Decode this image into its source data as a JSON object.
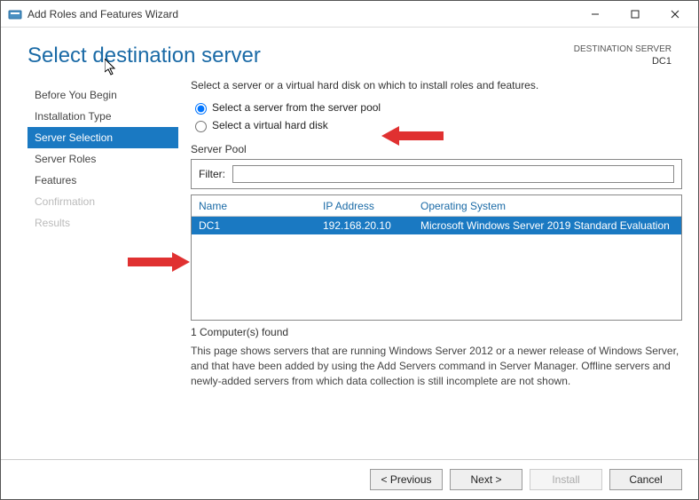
{
  "window": {
    "title": "Add Roles and Features Wizard"
  },
  "page": {
    "title": "Select destination server",
    "dest_label": "DESTINATION SERVER",
    "dest_name": "DC1"
  },
  "nav": {
    "items": [
      {
        "label": "Before You Begin",
        "state": "normal"
      },
      {
        "label": "Installation Type",
        "state": "normal"
      },
      {
        "label": "Server Selection",
        "state": "selected"
      },
      {
        "label": "Server Roles",
        "state": "normal"
      },
      {
        "label": "Features",
        "state": "normal"
      },
      {
        "label": "Confirmation",
        "state": "disabled"
      },
      {
        "label": "Results",
        "state": "disabled"
      }
    ]
  },
  "content": {
    "instruction": "Select a server or a virtual hard disk on which to install roles and features.",
    "radio1": "Select a server from the server pool",
    "radio2": "Select a virtual hard disk",
    "section_label": "Server Pool",
    "filter_label": "Filter:",
    "filter_value": "",
    "columns": {
      "name": "Name",
      "ip": "IP Address",
      "os": "Operating System"
    },
    "rows": [
      {
        "name": "DC1",
        "ip": "192.168.20.10",
        "os": "Microsoft Windows Server 2019 Standard Evaluation"
      }
    ],
    "count_text": "1 Computer(s) found",
    "help_text": "This page shows servers that are running Windows Server 2012 or a newer release of Windows Server, and that have been added by using the Add Servers command in Server Manager. Offline servers and newly-added servers from which data collection is still incomplete are not shown."
  },
  "footer": {
    "previous": "< Previous",
    "next": "Next >",
    "install": "Install",
    "cancel": "Cancel"
  }
}
